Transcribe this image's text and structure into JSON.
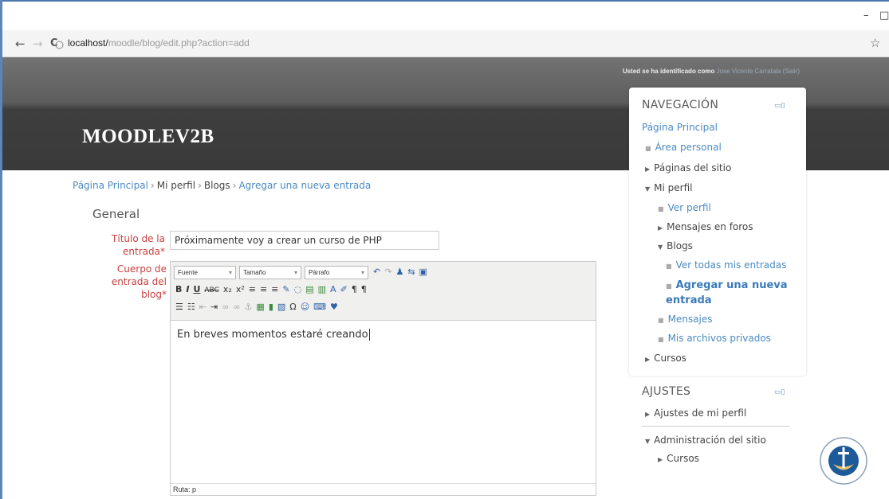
{
  "window": {
    "minimize": "–",
    "maximize": "□"
  },
  "browser": {
    "back": "←",
    "forward": "→",
    "reload": "C",
    "url_host": "localhost/",
    "url_path": "moodle/blog/edit.php?action=add",
    "star": "☆"
  },
  "header": {
    "login_prefix": "Usted se ha identificado como",
    "user_name": "Jose Vicente Carratala",
    "logout": "(Salir)",
    "site_name": "MOODLEV2B"
  },
  "breadcrumb": [
    "Página Principal",
    "Mi perfil",
    "Blogs",
    "Agregar una nueva entrada"
  ],
  "breadcrumb_sep": "›",
  "form": {
    "legend": "General",
    "title_label": "Título de la entrada*",
    "title_value": "Próximamente voy a crear un curso de PHP",
    "body_label": "Cuerpo de entrada del blog*",
    "editor": {
      "font_select": "Fuente",
      "size_select": "Tamaño",
      "format_select": "Párrafo",
      "content": "En breves momentos estaré creando",
      "path_text": "Ruta: p"
    }
  },
  "navigation": {
    "title": "NAVEGACIÓN",
    "items": [
      "Página Principal",
      "Área personal",
      "Páginas del sitio",
      "Mi perfil",
      "Ver perfil",
      "Mensajes en foros",
      "Blogs",
      "Ver todas mis entradas",
      "Agregar una nueva entrada",
      "Mensajes",
      "Mis archivos privados",
      "Cursos"
    ]
  },
  "settings": {
    "title": "AJUSTES",
    "items": [
      "Ajustes de mi perfil",
      "Administración del sitio",
      "Cursos"
    ]
  },
  "colors": {
    "accent_link": "#4a8ac0",
    "required_label": "#c84040",
    "header_dark": "#3a3a3a"
  }
}
